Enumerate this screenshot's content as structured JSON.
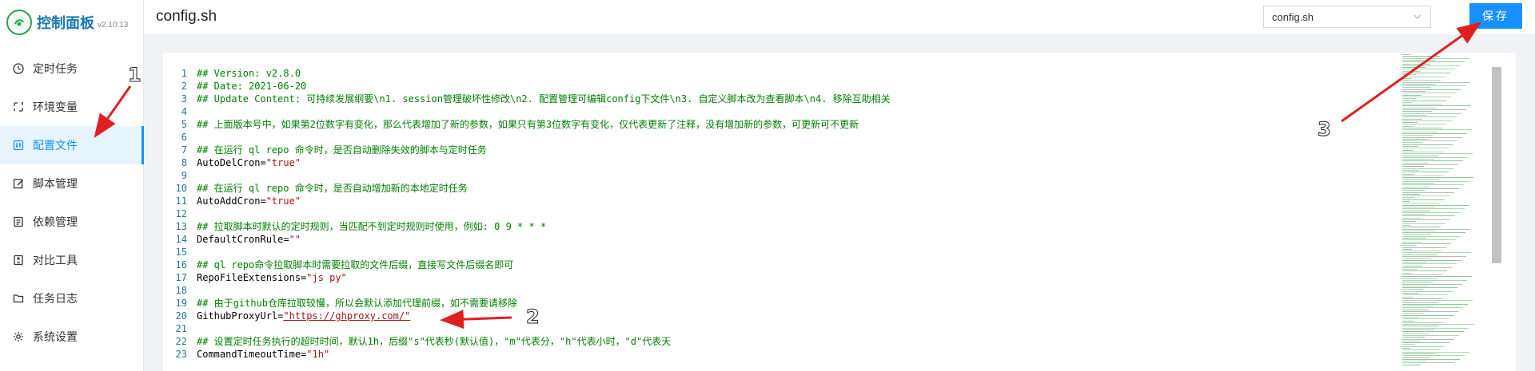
{
  "app": {
    "title": "控制面板",
    "version": "v2.10.13"
  },
  "sidebar": {
    "items": [
      {
        "label": "定时任务",
        "icon": "clock-icon"
      },
      {
        "label": "环境变量",
        "icon": "variable-icon"
      },
      {
        "label": "配置文件",
        "icon": "control-icon",
        "active": true
      },
      {
        "label": "脚本管理",
        "icon": "edit-icon"
      },
      {
        "label": "依赖管理",
        "icon": "dependency-icon"
      },
      {
        "label": "对比工具",
        "icon": "diff-icon"
      },
      {
        "label": "任务日志",
        "icon": "folder-icon"
      },
      {
        "label": "系统设置",
        "icon": "gear-icon"
      }
    ]
  },
  "header": {
    "title": "config.sh",
    "file_select": "config.sh",
    "save_label": "保存"
  },
  "editor": {
    "lines": [
      {
        "n": "1",
        "cls": "cm",
        "text": "## Version: v2.8.0"
      },
      {
        "n": "2",
        "cls": "cm",
        "text": "## Date: 2021-06-20"
      },
      {
        "n": "3",
        "cls": "cm",
        "text": "## Update Content: 可持续发展纲要\\n1. session管理破坏性修改\\n2. 配置管理可编辑config下文件\\n3. 自定义脚本改为查看脚本\\n4. 移除互助相关"
      },
      {
        "n": "4",
        "cls": "",
        "text": ""
      },
      {
        "n": "5",
        "cls": "cm",
        "text": "## 上面版本号中，如果第2位数字有变化，那么代表增加了新的参数，如果只有第3位数字有变化，仅代表更新了注释，没有增加新的参数，可更新可不更新"
      },
      {
        "n": "6",
        "cls": "",
        "text": ""
      },
      {
        "n": "7",
        "cls": "cm",
        "text": "## 在运行 ql repo 命令时，是否自动删除失效的脚本与定时任务"
      },
      {
        "n": "8",
        "cls": "kv",
        "key": "AutoDelCron=",
        "val": "\"true\""
      },
      {
        "n": "9",
        "cls": "",
        "text": ""
      },
      {
        "n": "10",
        "cls": "cm",
        "text": "## 在运行 ql repo 命令时，是否自动增加新的本地定时任务"
      },
      {
        "n": "11",
        "cls": "kv",
        "key": "AutoAddCron=",
        "val": "\"true\""
      },
      {
        "n": "12",
        "cls": "",
        "text": ""
      },
      {
        "n": "13",
        "cls": "cm",
        "text": "## 拉取脚本时默认的定时规则，当匹配不到定时规则时使用，例如: 0 9 * * *"
      },
      {
        "n": "14",
        "cls": "kv",
        "key": "DefaultCronRule=",
        "val": "\"\""
      },
      {
        "n": "15",
        "cls": "",
        "text": ""
      },
      {
        "n": "16",
        "cls": "cm",
        "text": "## ql repo命令拉取脚本时需要拉取的文件后缀，直接写文件后缀名即可"
      },
      {
        "n": "17",
        "cls": "kv",
        "key": "RepoFileExtensions=",
        "val": "\"js py\""
      },
      {
        "n": "18",
        "cls": "",
        "text": ""
      },
      {
        "n": "19",
        "cls": "cm",
        "text": "## 由于github仓库拉取较慢，所以会默认添加代理前缀，如不需要请移除"
      },
      {
        "n": "20",
        "cls": "url",
        "key": "GithubProxyUrl=",
        "val": "\"https://ghproxy.com/\""
      },
      {
        "n": "21",
        "cls": "",
        "text": ""
      },
      {
        "n": "22",
        "cls": "cm",
        "text": "## 设置定时任务执行的超时时间，默认1h，后缀\"s\"代表秒(默认值)，\"m\"代表分，\"h\"代表小时，\"d\"代表天"
      },
      {
        "n": "23",
        "cls": "kv",
        "key": "CommandTimeoutTime=",
        "val": "\"1h\""
      }
    ]
  },
  "annotations": {
    "labels": [
      "1",
      "2",
      "3"
    ],
    "arrow_color": "#e02020"
  },
  "colors": {
    "accent": "#1890ff",
    "comment": "#008000",
    "string": "#a31515",
    "line_number": "#237893"
  }
}
